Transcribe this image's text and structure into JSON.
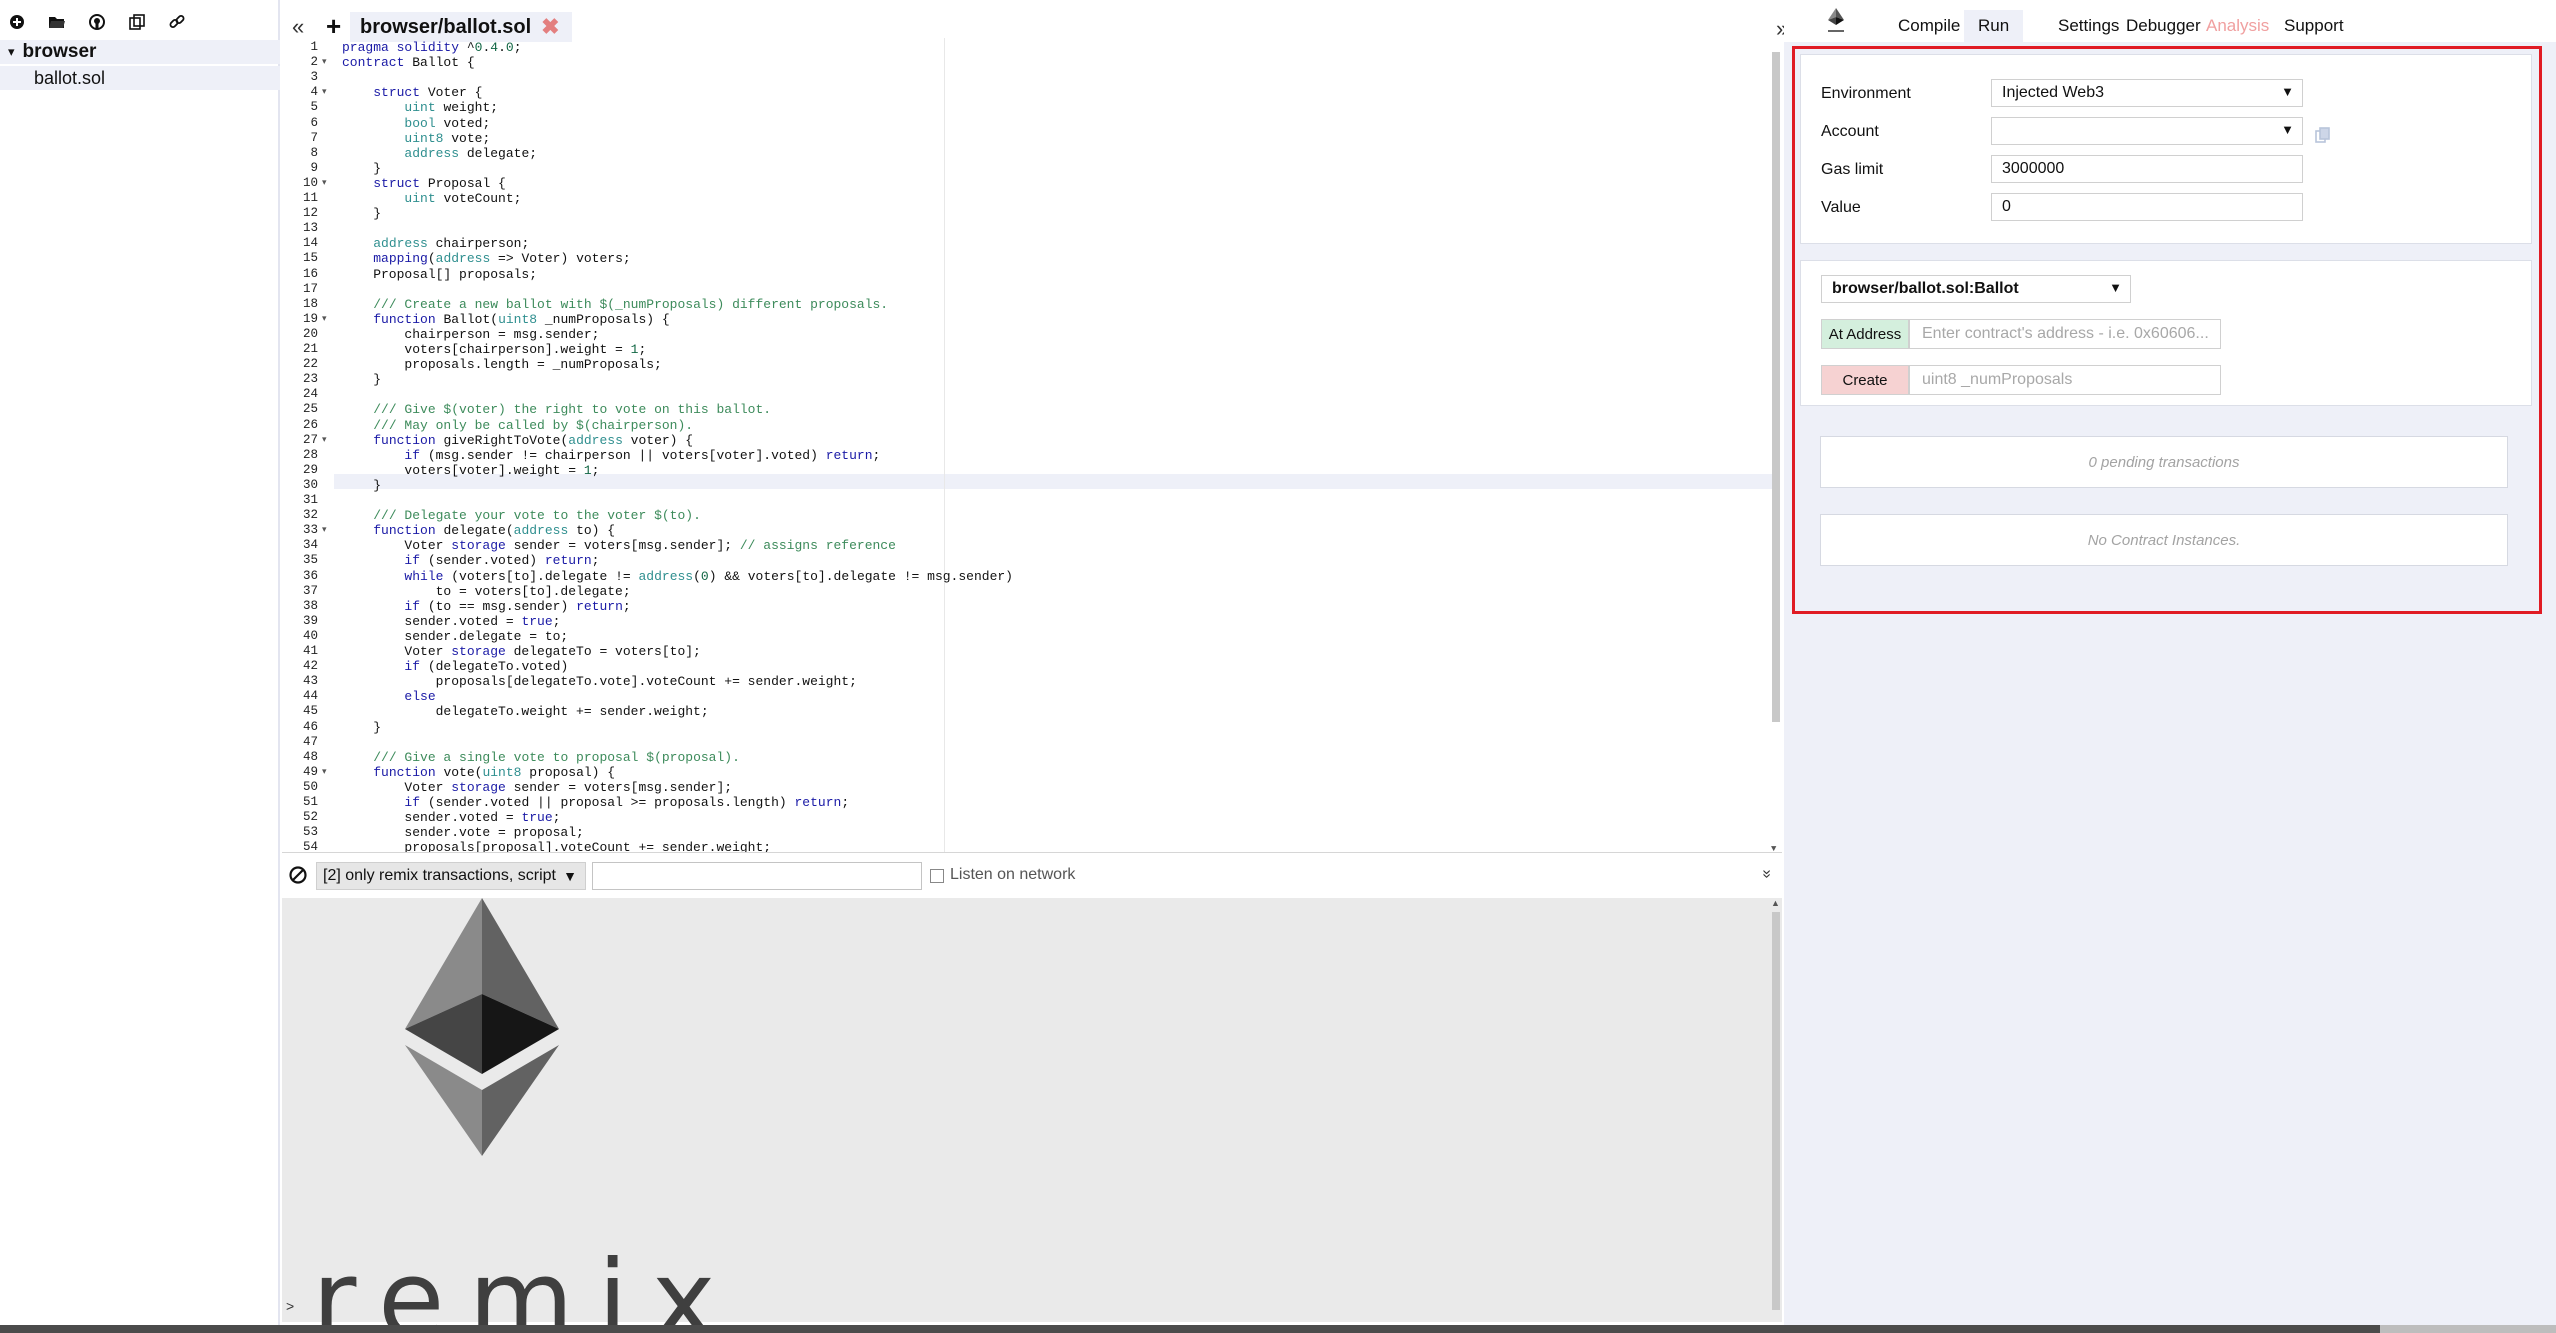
{
  "file_explorer": {
    "toolbar_icons": [
      "plus-circle-icon",
      "folder-open-icon",
      "github-icon",
      "copy-files-icon",
      "link-icon"
    ],
    "root_folder": "browser",
    "files": [
      "ballot.sol"
    ]
  },
  "editor": {
    "collapse_left": "«",
    "add_tab": "+",
    "active_tab": "browser/ballot.sol",
    "close_glyph": "✖",
    "expand_right": "»",
    "lines": [
      {
        "n": "1",
        "fold": "",
        "code": "pragma solidity ^0.4.0;"
      },
      {
        "n": "2",
        "fold": "▾",
        "code": "contract Ballot {"
      },
      {
        "n": "3",
        "fold": "",
        "code": ""
      },
      {
        "n": "4",
        "fold": "▾",
        "code": "    struct Voter {"
      },
      {
        "n": "5",
        "fold": "",
        "code": "        uint weight;"
      },
      {
        "n": "6",
        "fold": "",
        "code": "        bool voted;"
      },
      {
        "n": "7",
        "fold": "",
        "code": "        uint8 vote;"
      },
      {
        "n": "8",
        "fold": "",
        "code": "        address delegate;"
      },
      {
        "n": "9",
        "fold": "",
        "code": "    }"
      },
      {
        "n": "10",
        "fold": "▾",
        "code": "    struct Proposal {"
      },
      {
        "n": "11",
        "fold": "",
        "code": "        uint voteCount;"
      },
      {
        "n": "12",
        "fold": "",
        "code": "    }"
      },
      {
        "n": "13",
        "fold": "",
        "code": ""
      },
      {
        "n": "14",
        "fold": "",
        "code": "    address chairperson;"
      },
      {
        "n": "15",
        "fold": "",
        "code": "    mapping(address => Voter) voters;"
      },
      {
        "n": "16",
        "fold": "",
        "code": "    Proposal[] proposals;"
      },
      {
        "n": "17",
        "fold": "",
        "code": ""
      },
      {
        "n": "18",
        "fold": "",
        "code": "    /// Create a new ballot with $(_numProposals) different proposals."
      },
      {
        "n": "19",
        "fold": "▾",
        "code": "    function Ballot(uint8 _numProposals) {"
      },
      {
        "n": "20",
        "fold": "",
        "code": "        chairperson = msg.sender;"
      },
      {
        "n": "21",
        "fold": "",
        "code": "        voters[chairperson].weight = 1;"
      },
      {
        "n": "22",
        "fold": "",
        "code": "        proposals.length = _numProposals;"
      },
      {
        "n": "23",
        "fold": "",
        "code": "    }"
      },
      {
        "n": "24",
        "fold": "",
        "code": ""
      },
      {
        "n": "25",
        "fold": "",
        "code": "    /// Give $(voter) the right to vote on this ballot."
      },
      {
        "n": "26",
        "fold": "",
        "code": "    /// May only be called by $(chairperson)."
      },
      {
        "n": "27",
        "fold": "▾",
        "code": "    function giveRightToVote(address voter) {"
      },
      {
        "n": "28",
        "fold": "",
        "code": "        if (msg.sender != chairperson || voters[voter].voted) return;"
      },
      {
        "n": "29",
        "fold": "",
        "code": "        voters[voter].weight = 1;"
      },
      {
        "n": "30",
        "fold": "",
        "code": "    }"
      },
      {
        "n": "31",
        "fold": "",
        "code": ""
      },
      {
        "n": "32",
        "fold": "",
        "code": "    /// Delegate your vote to the voter $(to)."
      },
      {
        "n": "33",
        "fold": "▾",
        "code": "    function delegate(address to) {"
      },
      {
        "n": "34",
        "fold": "",
        "code": "        Voter storage sender = voters[msg.sender]; // assigns reference"
      },
      {
        "n": "35",
        "fold": "",
        "code": "        if (sender.voted) return;"
      },
      {
        "n": "36",
        "fold": "",
        "code": "        while (voters[to].delegate != address(0) && voters[to].delegate != msg.sender)"
      },
      {
        "n": "37",
        "fold": "",
        "code": "            to = voters[to].delegate;"
      },
      {
        "n": "38",
        "fold": "",
        "code": "        if (to == msg.sender) return;"
      },
      {
        "n": "39",
        "fold": "",
        "code": "        sender.voted = true;"
      },
      {
        "n": "40",
        "fold": "",
        "code": "        sender.delegate = to;"
      },
      {
        "n": "41",
        "fold": "",
        "code": "        Voter storage delegateTo = voters[to];"
      },
      {
        "n": "42",
        "fold": "",
        "code": "        if (delegateTo.voted)"
      },
      {
        "n": "43",
        "fold": "",
        "code": "            proposals[delegateTo.vote].voteCount += sender.weight;"
      },
      {
        "n": "44",
        "fold": "",
        "code": "        else"
      },
      {
        "n": "45",
        "fold": "",
        "code": "            delegateTo.weight += sender.weight;"
      },
      {
        "n": "46",
        "fold": "",
        "code": "    }"
      },
      {
        "n": "47",
        "fold": "",
        "code": ""
      },
      {
        "n": "48",
        "fold": "",
        "code": "    /// Give a single vote to proposal $(proposal)."
      },
      {
        "n": "49",
        "fold": "▾",
        "code": "    function vote(uint8 proposal) {"
      },
      {
        "n": "50",
        "fold": "",
        "code": "        Voter storage sender = voters[msg.sender];"
      },
      {
        "n": "51",
        "fold": "",
        "code": "        if (sender.voted || proposal >= proposals.length) return;"
      },
      {
        "n": "52",
        "fold": "",
        "code": "        sender.voted = true;"
      },
      {
        "n": "53",
        "fold": "",
        "code": "        sender.vote = proposal;"
      },
      {
        "n": "54",
        "fold": "",
        "code": "        proposals[proposal].voteCount += sender.weight;"
      }
    ]
  },
  "terminal": {
    "filter_value": "[2] only remix transactions, script",
    "search_value": "",
    "listen_label": "Listen on network",
    "collapse_glyph": "»",
    "wordmark": "remix",
    "prompt": ">"
  },
  "run_panel": {
    "tabs": [
      "Compile",
      "Run",
      "Settings",
      "Debugger",
      "Analysis",
      "Support"
    ],
    "active_tab": "Run",
    "environment_label": "Environment",
    "environment_value": "Injected Web3",
    "account_label": "Account",
    "account_value": "",
    "gas_limit_label": "Gas limit",
    "gas_limit_value": "3000000",
    "value_label": "Value",
    "value_value": "0",
    "contract_value": "browser/ballot.sol:Ballot",
    "at_address_label": "At Address",
    "at_address_placeholder": "Enter contract's address - i.e. 0x60606...",
    "create_label": "Create",
    "create_placeholder": "uint8 _numProposals",
    "pending_text": "0 pending transactions",
    "instances_text": "No Contract Instances."
  },
  "colors": {
    "highlight_border": "#e01b24",
    "panel_bg": "#eef0f8",
    "at_address_bg": "#d4efdd",
    "create_bg": "#f6d2d2",
    "analysis_tab": "#f0a0a0"
  }
}
